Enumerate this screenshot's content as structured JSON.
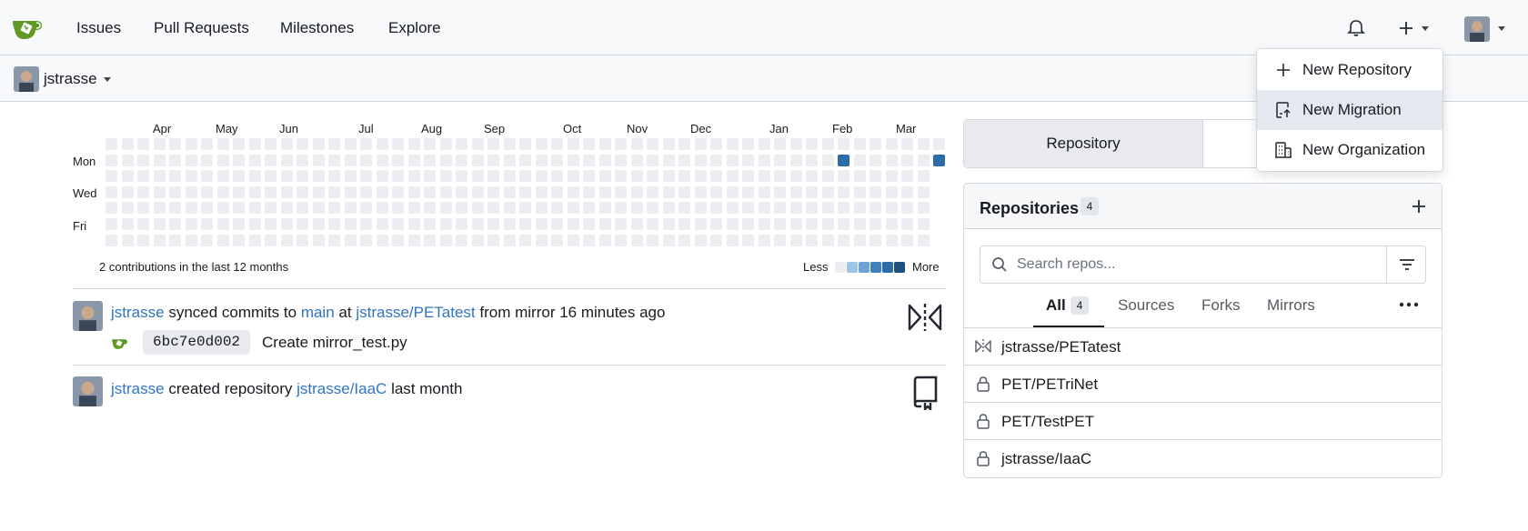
{
  "topnav": {
    "logo_icon": "gitea-logo-icon",
    "links": [
      "Issues",
      "Pull Requests",
      "Milestones",
      "Explore"
    ],
    "right_icons": [
      "bell-icon",
      "plus-icon",
      "avatar"
    ]
  },
  "context": {
    "user": "jstrasse"
  },
  "heatmap": {
    "months": [
      "Apr",
      "May",
      "Jun",
      "Jul",
      "Aug",
      "Sep",
      "Oct",
      "Nov",
      "Dec",
      "Jan",
      "Feb",
      "Mar"
    ],
    "days": [
      "Mon",
      "Wed",
      "Fri"
    ],
    "summary": "2 contributions in the last 12 months",
    "legend_less": "Less",
    "legend_more": "More",
    "legend_colors": [
      "#ebedf0",
      "#9ec4e6",
      "#6ea4d6",
      "#3d7fbf",
      "#2e6ca8",
      "#1f4f7e"
    ]
  },
  "feed": [
    {
      "user": "jstrasse",
      "action": "synced commits to",
      "branch": "main",
      "at": "at",
      "repo": "jstrasse/PETatest",
      "suffix": "from mirror 16 minutes ago",
      "icon": "mirror-icon",
      "commit": {
        "sha": "6bc7e0d002",
        "message": "Create mirror_test.py"
      }
    },
    {
      "user": "jstrasse",
      "action": "created repository",
      "repo": "jstrasse/IaaC",
      "suffix": "last month",
      "icon": "repo-icon"
    }
  ],
  "sidebar": {
    "tab_repository": "Repository",
    "repos_title": "Repositories",
    "repos_count": "4",
    "search_placeholder": "Search repos...",
    "tabs": [
      {
        "label": "All",
        "count": "4"
      },
      {
        "label": "Sources"
      },
      {
        "label": "Forks"
      },
      {
        "label": "Mirrors"
      }
    ],
    "repos": [
      {
        "name": "jstrasse/PETatest",
        "icon": "mirror-icon"
      },
      {
        "name": "PET/PETriNet",
        "icon": "lock-icon"
      },
      {
        "name": "PET/TestPET",
        "icon": "lock-icon"
      },
      {
        "name": "jstrasse/IaaC",
        "icon": "lock-icon"
      }
    ]
  },
  "dropdown": {
    "items": [
      {
        "label": "New Repository",
        "icon": "plus-icon"
      },
      {
        "label": "New Migration",
        "icon": "migration-icon"
      },
      {
        "label": "New Organization",
        "icon": "organization-icon"
      }
    ]
  },
  "colors": {
    "link": "#2f75c0",
    "accent_cell": "#2e6ca8",
    "logo": "#609926"
  }
}
